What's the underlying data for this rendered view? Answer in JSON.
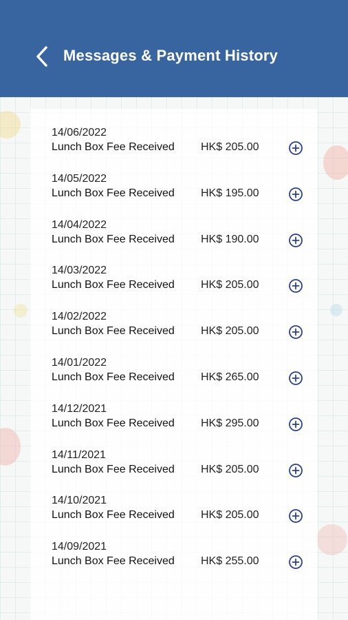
{
  "header": {
    "title": "Messages & Payment History",
    "background": "#3865a0",
    "back_icon": "chevron-left-icon"
  },
  "colors": {
    "accent_icon": "#2b3f8a",
    "header_bg": "#3865a0"
  },
  "payments": [
    {
      "date": "14/06/2022",
      "description": "Lunch Box Fee Received",
      "amount": "HK$ 205.00"
    },
    {
      "date": "14/05/2022",
      "description": "Lunch Box Fee Received",
      "amount": "HK$ 195.00"
    },
    {
      "date": "14/04/2022",
      "description": "Lunch Box Fee Received",
      "amount": "HK$ 190.00"
    },
    {
      "date": "14/03/2022",
      "description": "Lunch Box Fee Received",
      "amount": "HK$ 205.00"
    },
    {
      "date": "14/02/2022",
      "description": "Lunch Box Fee Received",
      "amount": "HK$ 205.00"
    },
    {
      "date": "14/01/2022",
      "description": "Lunch Box Fee Received",
      "amount": "HK$ 265.00"
    },
    {
      "date": "14/12/2021",
      "description": "Lunch Box Fee Received",
      "amount": "HK$ 295.00"
    },
    {
      "date": "14/11/2021",
      "description": "Lunch Box Fee Received",
      "amount": "HK$ 205.00"
    },
    {
      "date": "14/10/2021",
      "description": "Lunch Box Fee Received",
      "amount": "HK$ 205.00"
    },
    {
      "date": "14/09/2021",
      "description": "Lunch Box Fee Received",
      "amount": "HK$ 255.00"
    }
  ],
  "row_action_icon": "plus-circle-icon"
}
